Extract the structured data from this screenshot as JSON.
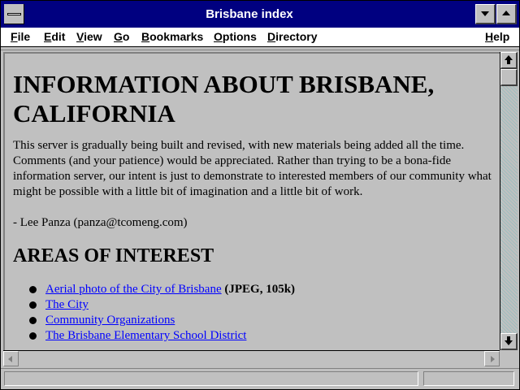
{
  "window": {
    "title": "Brisbane index",
    "system_menu_icon": "system-menu-icon",
    "minimize_icon": "minimize-icon",
    "maximize_icon": "maximize-icon"
  },
  "menu": {
    "file": "File",
    "edit": "Edit",
    "view": "View",
    "go": "Go",
    "bookmarks": "Bookmarks",
    "options": "Options",
    "directory": "Directory",
    "help": "Help"
  },
  "page": {
    "heading": "INFORMATION ABOUT BRISBANE, CALIFORNIA",
    "intro": "This server is gradually being built and revised, with new materials being added all the time. Comments (and your patience) would be appreciated. Rather than trying to be a bona-fide information server, our intent is just to demonstrate to interested members of our community what might be possible with a little bit of imagination and a little bit of work.",
    "signature": "- Lee Panza (panza@tcomeng.com)",
    "section_heading": "AREAS OF INTEREST",
    "links": [
      {
        "label": "Aerial photo of the City of Brisbane",
        "suffix": " (JPEG, 105k)"
      },
      {
        "label": "The City",
        "suffix": ""
      },
      {
        "label": "Community Organizations",
        "suffix": ""
      },
      {
        "label": "The Brisbane Elementary School District",
        "suffix": ""
      }
    ]
  },
  "colors": {
    "title_bar": "#000080",
    "link": "#0000ff",
    "page_background": "#c0c0c0"
  }
}
